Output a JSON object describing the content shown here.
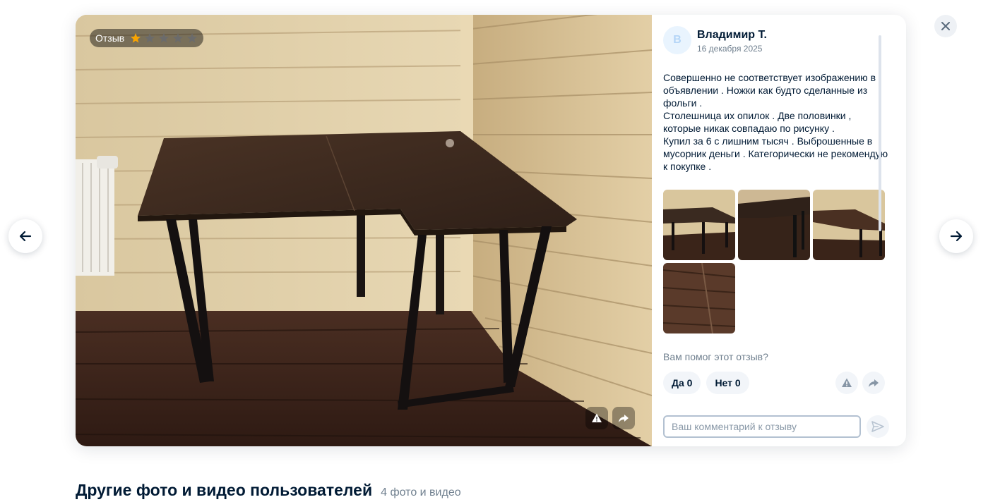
{
  "badge": {
    "label": "Отзыв",
    "rating": 1,
    "max_rating": 5,
    "star_color": "#f9a400",
    "star_empty_color": "#6b6b6b"
  },
  "author": {
    "initial": "В",
    "name": "Владимир Т.",
    "date": "16 декабря 2025"
  },
  "review": {
    "lines": [
      "Совершенно не соответствует изображению в объявлении . Ножки как будто сделанные из фольги .",
      "Столешница их опилок . Две половинки , которые никак совпадаю по рисунку .",
      "Купил за 6 с лишним тысяч . Выброшенные в мусорник деньги . Категорически не рекомендую к покупке ."
    ]
  },
  "thumbnails": [
    {
      "name": "review-photo-1",
      "alt": "desk-photo-icon"
    },
    {
      "name": "review-photo-2",
      "alt": "desk-photo-icon"
    },
    {
      "name": "review-photo-3",
      "alt": "desk-photo-icon"
    },
    {
      "name": "review-photo-4",
      "alt": "desk-photo-icon"
    }
  ],
  "helpful": {
    "question": "Вам помог этот отзыв?",
    "yes_label": "Да 0",
    "no_label": "Нет 0"
  },
  "comment": {
    "placeholder": "Ваш комментарий к отзыву"
  },
  "icons": {
    "close": "close-icon",
    "prev": "arrow-left-icon",
    "next": "arrow-right-icon",
    "report": "warning-icon",
    "share": "share-icon",
    "send": "send-icon"
  },
  "section": {
    "title": "Другие фото и видео пользователей",
    "count": "4 фото и видео"
  },
  "colors": {
    "text_primary": "#001a34",
    "text_secondary": "#70808f",
    "button_bg": "#f2f5f9"
  }
}
